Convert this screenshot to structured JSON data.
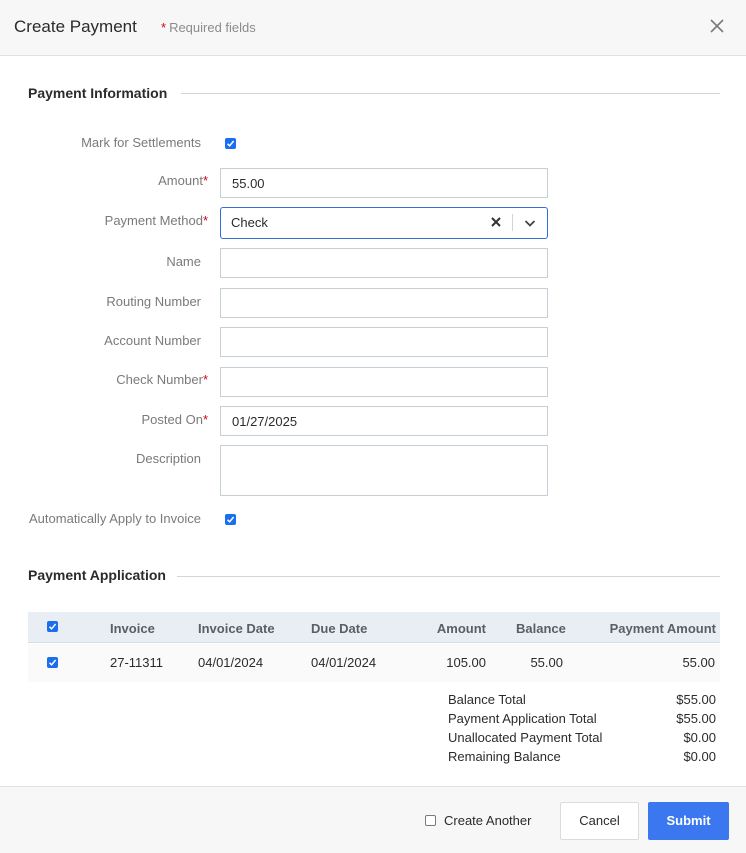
{
  "header": {
    "title": "Create Payment",
    "required_star": "*",
    "required_note": "Required fields",
    "close_icon": "close-icon"
  },
  "payment_information": {
    "title": "Payment Information",
    "fields": {
      "mark_for_settlements": {
        "label": "Mark for Settlements",
        "checked": true
      },
      "amount": {
        "label": "Amount",
        "required": true,
        "value": "55.00"
      },
      "payment_method": {
        "label": "Payment Method",
        "required": true,
        "value": "Check"
      },
      "name": {
        "label": "Name",
        "value": ""
      },
      "routing_number": {
        "label": "Routing Number",
        "value": ""
      },
      "account_number": {
        "label": "Account Number",
        "value": ""
      },
      "check_number": {
        "label": "Check Number",
        "required": true,
        "value": ""
      },
      "posted_on": {
        "label": "Posted On",
        "required": true,
        "value": "01/27/2025"
      },
      "description": {
        "label": "Description",
        "value": ""
      },
      "auto_apply": {
        "label": "Automatically Apply to Invoice",
        "checked": true
      }
    }
  },
  "payment_application": {
    "title": "Payment Application",
    "columns": [
      "Invoice",
      "Invoice Date",
      "Due Date",
      "Amount",
      "Balance",
      "Payment Amount"
    ],
    "rows": [
      {
        "checked": true,
        "invoice": "27-11311",
        "invoice_date": "04/01/2024",
        "due_date": "04/01/2024",
        "amount": "105.00",
        "balance": "55.00",
        "payment_amount": "55.00"
      }
    ],
    "totals": [
      {
        "label": "Balance Total",
        "value": "$55.00"
      },
      {
        "label": "Payment Application Total",
        "value": "$55.00"
      },
      {
        "label": "Unallocated Payment Total",
        "value": "$0.00"
      },
      {
        "label": "Remaining Balance",
        "value": "$0.00"
      }
    ]
  },
  "footer": {
    "create_another": {
      "label": "Create Another",
      "checked": false
    },
    "cancel_label": "Cancel",
    "submit_label": "Submit"
  },
  "colors": {
    "accent": "#3b78f0",
    "required": "#d0021b",
    "checkbox": "#1a6ef0"
  }
}
